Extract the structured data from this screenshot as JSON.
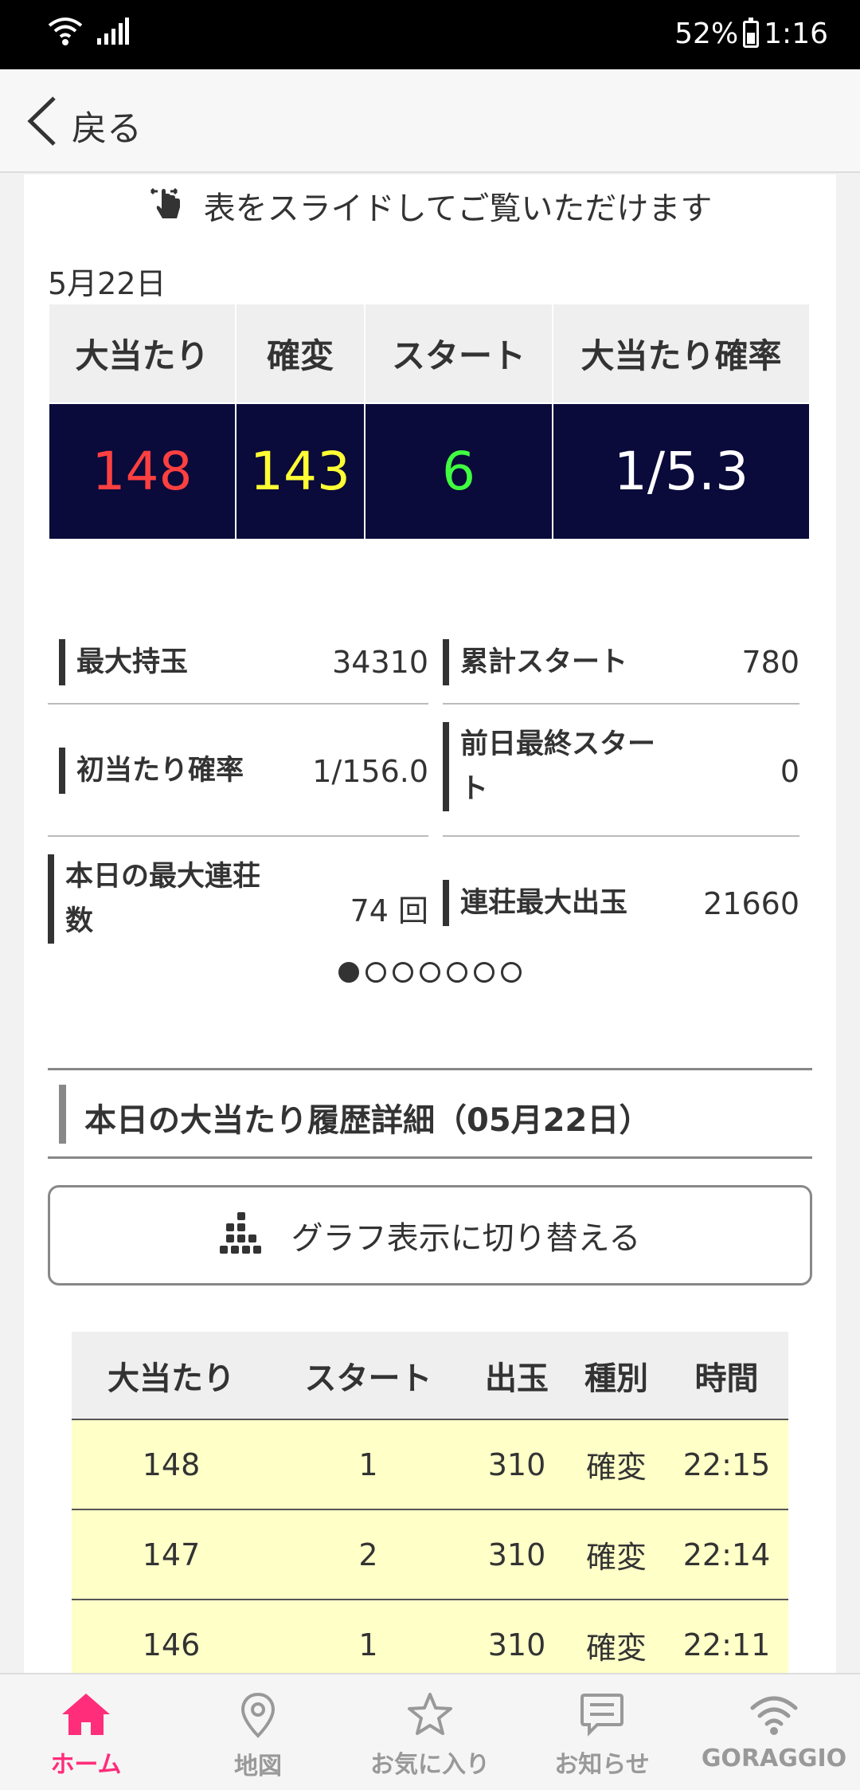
{
  "status_bar": {
    "battery": "52%",
    "time": "1:16"
  },
  "header": {
    "back_label": "戻る"
  },
  "slide_hint": "表をスライドしてご覧いただけます",
  "date_label": "5月22日",
  "summary": {
    "headers": [
      "大当たり",
      "確変",
      "スタート",
      "大当たり確率"
    ],
    "values": [
      "148",
      "143",
      "6",
      "1/5.3"
    ],
    "colors": {
      "red": "#ff4040",
      "yellow": "#ffff33",
      "green": "#40ff40",
      "navy": "#0a0a3b"
    }
  },
  "stats": [
    {
      "label": "最大持玉",
      "value": "34310"
    },
    {
      "label": "累計スタート",
      "value": "780"
    },
    {
      "label": "初当たり確率",
      "value": "1/156.0"
    },
    {
      "label": "前日最終スタート",
      "value": "0"
    },
    {
      "label": "本日の最大連荘数",
      "value": "74 回"
    },
    {
      "label": "連荘最大出玉",
      "value": "21660"
    }
  ],
  "pager": {
    "total": 7,
    "active": 1
  },
  "section_title": "本日の大当たり履歴詳細（05月22日）",
  "graph_button_label": "グラフ表示に切り替える",
  "history": {
    "headers": [
      "大当たり",
      "スタート",
      "出玉",
      "種別",
      "時間"
    ],
    "rows": [
      [
        "148",
        "1",
        "310",
        "確変",
        "22:15"
      ],
      [
        "147",
        "2",
        "310",
        "確変",
        "22:14"
      ],
      [
        "146",
        "1",
        "310",
        "確変",
        "22:11"
      ]
    ]
  },
  "bottom_nav": [
    {
      "label": "ホーム",
      "icon": "home-icon",
      "active": true
    },
    {
      "label": "地図",
      "icon": "map-pin-icon",
      "active": false
    },
    {
      "label": "お気に入り",
      "icon": "star-icon",
      "active": false
    },
    {
      "label": "お知らせ",
      "icon": "message-icon",
      "active": false
    },
    {
      "label": "GORAGGIO",
      "icon": "wifi-icon",
      "active": false
    }
  ]
}
